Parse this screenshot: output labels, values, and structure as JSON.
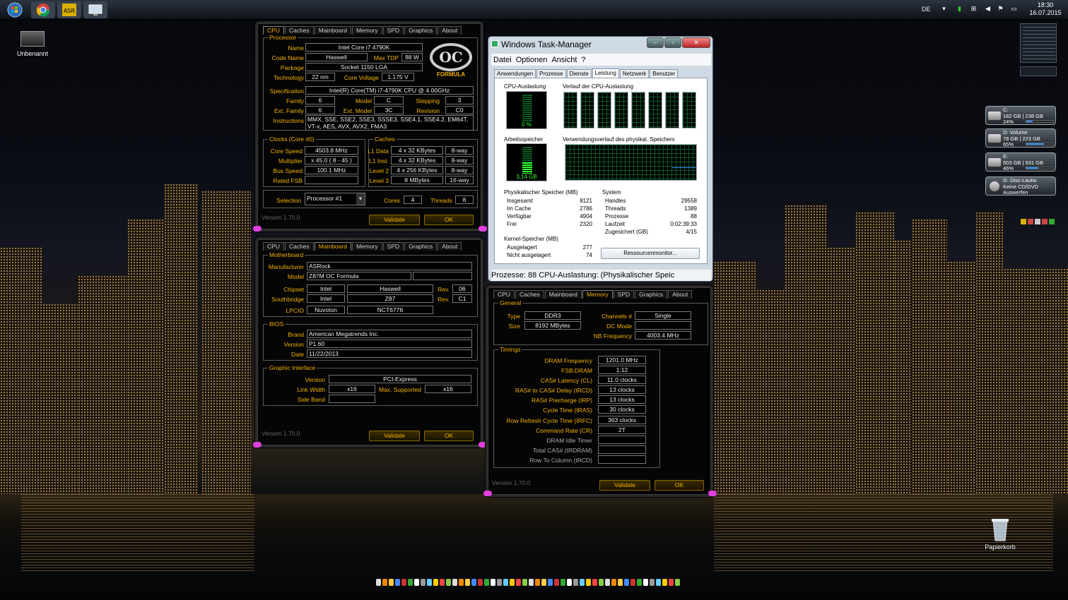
{
  "taskbar": {
    "apps": [
      {
        "name": "start-orb-icon",
        "color": "#3a8ad8"
      },
      {
        "name": "chrome-icon",
        "color": "#e8c020"
      },
      {
        "name": "asrock-icon",
        "color": "#d8b000"
      },
      {
        "name": "monitor-app-icon",
        "color": "#4a8a4a"
      }
    ],
    "language": "DE",
    "time": "18:30",
    "date": "16.07.2015"
  },
  "desktop": {
    "icon_unbenannt": "Unbenannt",
    "icon_recycle": "Papierkorb"
  },
  "cpuz_cpu": {
    "tabs": [
      "CPU",
      "Caches",
      "Mainboard",
      "Memory",
      "SPD",
      "Graphics",
      "About"
    ],
    "processor_title": "Processor",
    "name_label": "Name",
    "name": "Intel Core i7 4790K",
    "codename_label": "Code Name",
    "codename": "Haswell",
    "maxtdp_label": "Max TDP",
    "maxtdp": "88 W",
    "package_label": "Package",
    "package": "Socket 1150 LGA",
    "technology_label": "Technology",
    "technology": "22 nm",
    "corevoltage_label": "Core Voltage",
    "corevoltage": "1.175 V",
    "spec_label": "Specification",
    "spec": "Intel(R) Core(TM) i7-4790K CPU @ 4.00GHz",
    "family_label": "Family",
    "family": "6",
    "model_label": "Model",
    "model": "C",
    "stepping_label": "Stepping",
    "stepping": "3",
    "extfamily_label": "Ext. Family",
    "extfamily": "6",
    "extmodel_label": "Ext. Model",
    "extmodel": "3C",
    "revision_label": "Revision",
    "revision": "C0",
    "instructions_label": "Instructions",
    "instructions1": "MMX, SSE, SSE2, SSE3, SSSE3, SSE4.1, SSE4.2, EM64T,",
    "instructions2": "VT-x, AES, AVX, AVX2, FMA3",
    "clocks_title": "Clocks (Core #0)",
    "corespeed_label": "Core Speed",
    "corespeed": "4503.8 MHz",
    "multiplier_label": "Multiplier",
    "multiplier": "x 45.0 ( 8 - 45 )",
    "busspeed_label": "Bus Speed",
    "busspeed": "100.1 MHz",
    "ratedfsb_label": "Rated FSB",
    "ratedfsb": "",
    "caches_title": "Caches",
    "l1d_label": "L1 Data",
    "l1d": "4 x 32 KBytes",
    "l1d_way": "8-way",
    "l1i_label": "L1 Inst.",
    "l1i": "4 x 32 KBytes",
    "l1i_way": "8-way",
    "l2_label": "Level 2",
    "l2": "4 x 256 KBytes",
    "l2_way": "8-way",
    "l3_label": "Level 3",
    "l3": "8 MBytes",
    "l3_way": "16-way",
    "selection_label": "Selection",
    "selection": "Processor #1",
    "cores_label": "Cores",
    "cores": "4",
    "threads_label": "Threads",
    "threads": "8",
    "logo_text": "FORMULA",
    "version": "Version 1.70.0",
    "validate": "Validate",
    "ok": "OK"
  },
  "cpuz_mb": {
    "tabs": [
      "CPU",
      "Caches",
      "Mainboard",
      "Memory",
      "SPD",
      "Graphics",
      "About"
    ],
    "mb_title": "Motherboard",
    "manufacturer_label": "Manufacturer",
    "manufacturer": "ASRock",
    "model_label": "Model",
    "model": "Z87M OC Formula",
    "model2": "",
    "chipset_label": "Chipset",
    "chipset_v": "Intel",
    "chipset_n": "Haswell",
    "chipset_rev_label": "Rev.",
    "chipset_rev": "06",
    "south_label": "Southbridge",
    "south_v": "Intel",
    "south_n": "Z87",
    "south_rev_label": "Rev.",
    "south_rev": "C1",
    "lpcio_label": "LPCIO",
    "lpcio_v": "Nuvoton",
    "lpcio_n": "NCT6776",
    "bios_title": "BIOS",
    "brand_label": "Brand",
    "brand": "American Megatrends Inc.",
    "version_label": "Version",
    "bios_version": "P1.60",
    "date_label": "Date",
    "date": "11/22/2013",
    "gi_title": "Graphic Interface",
    "gi_version_label": "Version",
    "gi_version": "PCI-Express",
    "linkwidth_label": "Link Width",
    "linkwidth": "x16",
    "maxsup_label": "Max. Supported",
    "maxsup": "x16",
    "sideband_label": "Side Band",
    "sideband": "",
    "version": "Version 1.70.0",
    "validate": "Validate",
    "ok": "OK"
  },
  "cpuz_mem": {
    "tabs": [
      "CPU",
      "Caches",
      "Mainboard",
      "Memory",
      "SPD",
      "Graphics",
      "About"
    ],
    "general_title": "General",
    "type_label": "Type",
    "type": "DDR3",
    "size_label": "Size",
    "size": "8192 MBytes",
    "channels_label": "Channels #",
    "channels": "Single",
    "dcmode_label": "DC Mode",
    "dcmode": "",
    "nbfreq_label": "NB Frequency",
    "nbfreq": "4003.4 MHz",
    "timings_title": "Timings",
    "timings": [
      {
        "label": "DRAM Frequency",
        "value": "1201.0 MHz"
      },
      {
        "label": "FSB:DRAM",
        "value": "1:12"
      },
      {
        "label": "CAS# Latency (CL)",
        "value": "11.0 clocks"
      },
      {
        "label": "RAS# to CAS# Delay (tRCD)",
        "value": "13 clocks"
      },
      {
        "label": "RAS# Precharge (tRP)",
        "value": "13 clocks"
      },
      {
        "label": "Cycle Time (tRAS)",
        "value": "30 clocks"
      },
      {
        "label": "Row Refresh Cycle Time (tRFC)",
        "value": "363 clocks"
      },
      {
        "label": "Command Rate (CR)",
        "value": "2T"
      },
      {
        "label": "DRAM Idle Timer",
        "value": ""
      },
      {
        "label": "Total CAS# (tRDRAM)",
        "value": ""
      },
      {
        "label": "Row To Column (tRCD)",
        "value": ""
      }
    ],
    "version": "Version 1.70.0",
    "validate": "Validate",
    "ok": "OK"
  },
  "taskmgr": {
    "title": "Windows Task-Manager",
    "menu": [
      "Datei",
      "Optionen",
      "Ansicht",
      "?"
    ],
    "tabs": [
      "Anwendungen",
      "Prozesse",
      "Dienste",
      "Leistung",
      "Netzwerk",
      "Benutzer"
    ],
    "cpu_usage_label": "CPU-Auslastung",
    "cpu_usage": "0 %",
    "cpu_history_label": "Verlauf der CPU-Auslastung",
    "mem_label": "Arbeitsspeicher",
    "mem_value": "3,14 GB",
    "mem_history_label": "Verwendungsverlauf des physikal. Speichers",
    "phys_title": "Physikalischer Speicher (MB)",
    "phys": [
      {
        "label": "Insgesamt",
        "value": "8121"
      },
      {
        "label": "Im Cache",
        "value": "2786"
      },
      {
        "label": "Verfügbar",
        "value": "4904"
      },
      {
        "label": "Frei",
        "value": "2320"
      }
    ],
    "sys_title": "System",
    "sys": [
      {
        "label": "Handles",
        "value": "29558"
      },
      {
        "label": "Threads",
        "value": "1389"
      },
      {
        "label": "Prozesse",
        "value": "88"
      },
      {
        "label": "Laufzeit",
        "value": "0:02:39:33"
      },
      {
        "label": "Zugesichert (GB)",
        "value": "4/15"
      }
    ],
    "kernel_title": "Kernel-Speicher (MB)",
    "kernel": [
      {
        "label": "Ausgelagert",
        "value": "277"
      },
      {
        "label": "Nicht ausgelagert",
        "value": "74"
      }
    ],
    "resmon_button": "Ressourcenmonitor...",
    "status": "Prozesse: 88    CPU-Auslastung: (Physikalischer Speic"
  },
  "gadgets": {
    "drives": [
      {
        "line1": "C:",
        "line2": "182 GB | 238 GB",
        "pct": "24%",
        "fill": 0.24
      },
      {
        "line1": "D: Volume",
        "line2": "78 GB | 223 GB",
        "pct": "65%",
        "fill": 0.65
      },
      {
        "line1": "E:",
        "line2": "503 GB | 931 GB",
        "pct": "46%",
        "fill": 0.46
      },
      {
        "line1": "G: Disc-Laufw.",
        "line2": "Keine CD/DVD",
        "pct": "Auswerfen",
        "fill": 0
      }
    ]
  }
}
